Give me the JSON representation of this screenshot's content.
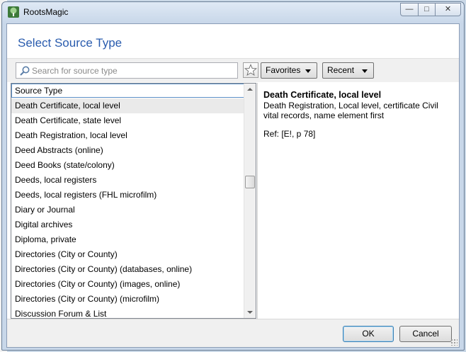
{
  "window": {
    "app_title": "RootsMagic",
    "dialog_title": "Select Source Type"
  },
  "toolbar": {
    "search_placeholder": "Search for source type",
    "favorites_label": "Favorites",
    "recent_label": "Recent"
  },
  "list": {
    "header": "Source Type",
    "items": [
      "Death Certificate, local level",
      "Death Certificate, state level",
      "Death Registration, local level",
      "Deed Abstracts (online)",
      "Deed Books (state/colony)",
      "Deeds, local registers",
      "Deeds, local registers (FHL microfilm)",
      "Diary or Journal",
      "Digital archives",
      "Diploma, private",
      "Directories (City or County)",
      "Directories (City or County) (databases, online)",
      "Directories (City or County) (images, online)",
      "Directories (City or County) (microfilm)",
      "Discussion Forum & List"
    ],
    "selected_index": 0
  },
  "detail": {
    "title": "Death Certificate, local level",
    "description": "Death Registration, Local level, certificate Civil vital records, name element first",
    "ref": "Ref: [E!, p 78]"
  },
  "footer": {
    "ok_label": "OK",
    "cancel_label": "Cancel"
  },
  "colors": {
    "title_blue": "#2a5cae",
    "selected_row": "#eaeaea",
    "chrome": "#c8d7e9"
  }
}
